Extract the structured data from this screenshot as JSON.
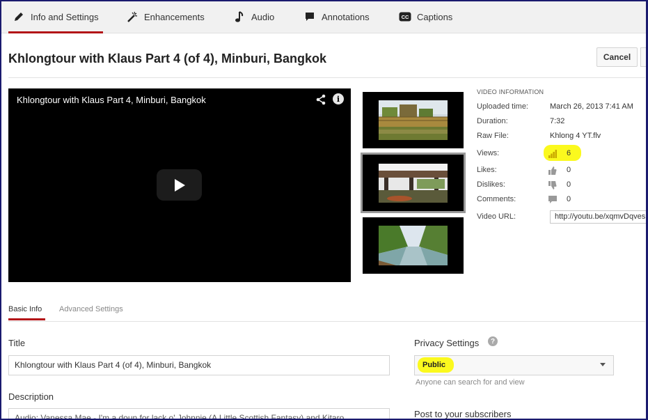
{
  "tabs": [
    {
      "label": "Info and Settings",
      "icon": "pencil-icon",
      "active": true
    },
    {
      "label": "Enhancements",
      "icon": "magic-wand-icon"
    },
    {
      "label": "Audio",
      "icon": "music-note-icon"
    },
    {
      "label": "Annotations",
      "icon": "speech-bubble-icon"
    },
    {
      "label": "Captions",
      "icon": "cc-icon"
    }
  ],
  "header": {
    "title": "Khlongtour with Klaus Part 4 (of 4), Minburi, Bangkok",
    "cancel_label": "Cancel"
  },
  "player": {
    "title": "Khlongtour with Klaus Part 4, Minburi, Bangkok",
    "icons": [
      "share-icon",
      "info-icon",
      "play-icon"
    ]
  },
  "thumbnails": [
    {
      "name": "thumbnail-1",
      "selected": false
    },
    {
      "name": "thumbnail-2",
      "selected": true
    },
    {
      "name": "thumbnail-3",
      "selected": false
    }
  ],
  "video_info": {
    "heading": "VIDEO INFORMATION",
    "uploaded_label": "Uploaded time:",
    "uploaded_value": "March 26, 2013 7:41 AM",
    "duration_label": "Duration:",
    "duration_value": "7:32",
    "raw_file_label": "Raw File:",
    "raw_file_value": "Khlong 4 YT.flv",
    "views_label": "Views:",
    "views_value": "6",
    "likes_label": "Likes:",
    "likes_value": "0",
    "dislikes_label": "Dislikes:",
    "dislikes_value": "0",
    "comments_label": "Comments:",
    "comments_value": "0",
    "url_label": "Video URL:",
    "url_value": "http://youtu.be/xqmvDqves"
  },
  "subtabs": {
    "basic": "Basic Info",
    "advanced": "Advanced Settings"
  },
  "form": {
    "title_label": "Title",
    "title_value": "Khlongtour with Klaus Part 4 (of 4), Minburi, Bangkok",
    "description_label": "Description",
    "description_value": "Audio: Vanessa Mae - I'm a doun for lack o' Johnnie (A Little Scottish Fantasy) and Kitaro",
    "privacy_label": "Privacy Settings",
    "privacy_value": "Public",
    "privacy_hint": "Anyone can search for and view",
    "post_label": "Post to your subscribers"
  },
  "colors": {
    "accent": "#b31217",
    "highlight": "#fbf91e",
    "views_icon": "#c9a800"
  }
}
